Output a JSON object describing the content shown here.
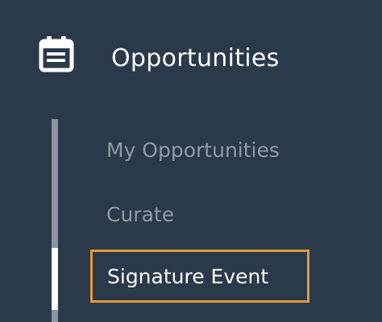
{
  "nav": {
    "section": {
      "title": "Opportunities",
      "icon": "calendar-list-icon",
      "items": [
        {
          "label": "My Opportunities",
          "active": false
        },
        {
          "label": "Curate",
          "active": false
        },
        {
          "label": "Signature Event",
          "active": true
        }
      ]
    }
  },
  "colors": {
    "background": "#2b3a4b",
    "text_active": "#ffffff",
    "text_inactive": "#8f9aa5",
    "focus_outline": "#e69a33",
    "track": "#8c96a0",
    "track_active": "#ffffff"
  }
}
